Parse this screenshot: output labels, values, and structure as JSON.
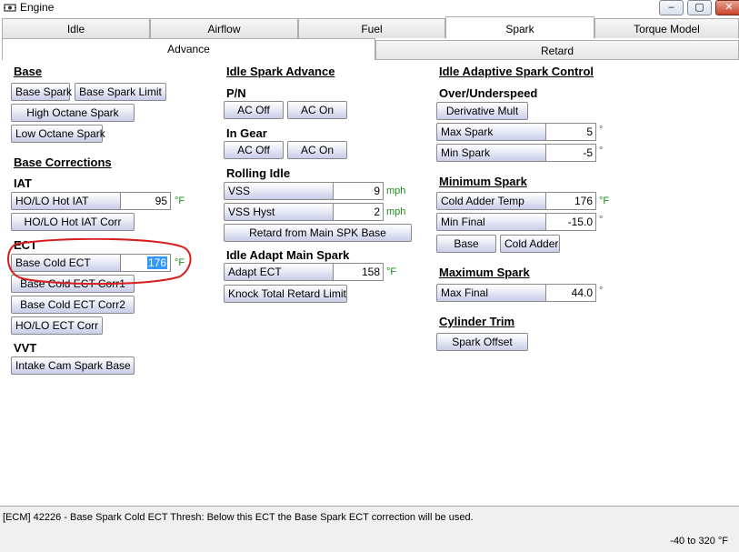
{
  "window": {
    "title": "Engine",
    "minimize": "–",
    "maximize": "▢",
    "close": "✕"
  },
  "tabs": [
    "Idle",
    "Airflow",
    "Fuel",
    "Spark",
    "Torque Model"
  ],
  "active_tab": "Spark",
  "subtabs": [
    "Advance",
    "Retard"
  ],
  "active_subtab": "Advance",
  "col1": {
    "base_header": "Base",
    "base_spark": "Base Spark",
    "base_spark_limit": "Base Spark Limit",
    "high_octane_spark": "High Octane Spark",
    "low_octane_spark": "Low Octane Spark",
    "base_corrections_header": "Base Corrections",
    "iat_label": "IAT",
    "holo_hot_iat": "HO/LO Hot IAT",
    "holo_hot_iat_value": "95",
    "holo_hot_iat_unit": "°F",
    "holo_hot_iat_corr": "HO/LO Hot IAT Corr",
    "ect_label": "ECT",
    "base_cold_ect": "Base Cold ECT",
    "base_cold_ect_value": "176",
    "base_cold_ect_unit": "°F",
    "base_cold_ect_corr1": "Base Cold ECT Corr1",
    "base_cold_ect_corr2": "Base Cold ECT Corr2",
    "holo_ect_corr": "HO/LO ECT Corr",
    "vvt_label": "VVT",
    "intake_cam_spark_base": "Intake Cam Spark Base"
  },
  "col2": {
    "idle_spark_advance_header": "Idle Spark Advance",
    "pn_label": "P/N",
    "pn_ac_off": "AC Off",
    "pn_ac_on": "AC On",
    "in_gear_label": "In Gear",
    "ig_ac_off": "AC Off",
    "ig_ac_on": "AC On",
    "rolling_idle_label": "Rolling Idle",
    "vss": "VSS",
    "vss_value": "9",
    "vss_unit": "mph",
    "vss_hyst": "VSS Hyst",
    "vss_hyst_value": "2",
    "vss_hyst_unit": "mph",
    "retard_from_main": "Retard from Main SPK Base",
    "idle_adapt_main_label": "Idle Adapt Main Spark",
    "adapt_ect": "Adapt ECT",
    "adapt_ect_value": "158",
    "adapt_ect_unit": "°F",
    "knock_total_retard_limit": "Knock Total Retard Limit"
  },
  "col3": {
    "idle_adaptive_header": "Idle Adaptive Spark Control",
    "over_under_label": "Over/Underspeed",
    "derivative_mult": "Derivative Mult",
    "max_spark": "Max Spark",
    "max_spark_value": "5",
    "max_spark_unit": "°",
    "min_spark": "Min Spark",
    "min_spark_value": "-5",
    "min_spark_unit": "°",
    "minimum_spark_header": "Minimum Spark",
    "cold_adder_temp": "Cold Adder Temp",
    "cold_adder_temp_value": "176",
    "cold_adder_temp_unit": "°F",
    "min_final": "Min Final",
    "min_final_value": "-15.0",
    "min_final_unit": "°",
    "base_btn": "Base",
    "cold_adder_btn": "Cold Adder",
    "maximum_spark_header": "Maximum Spark",
    "max_final": "Max Final",
    "max_final_value": "44.0",
    "max_final_unit": "°",
    "cylinder_trim_header": "Cylinder Trim",
    "spark_offset": "Spark Offset"
  },
  "status": {
    "message": "[ECM] 42226 - Base Spark Cold ECT Thresh: Below this ECT the Base Spark ECT correction will be used.",
    "range": "-40 to 320 °F"
  },
  "colors": {
    "annotation": "#d62020",
    "unit_green": "#1a8c1a",
    "selection": "#3399ff"
  }
}
